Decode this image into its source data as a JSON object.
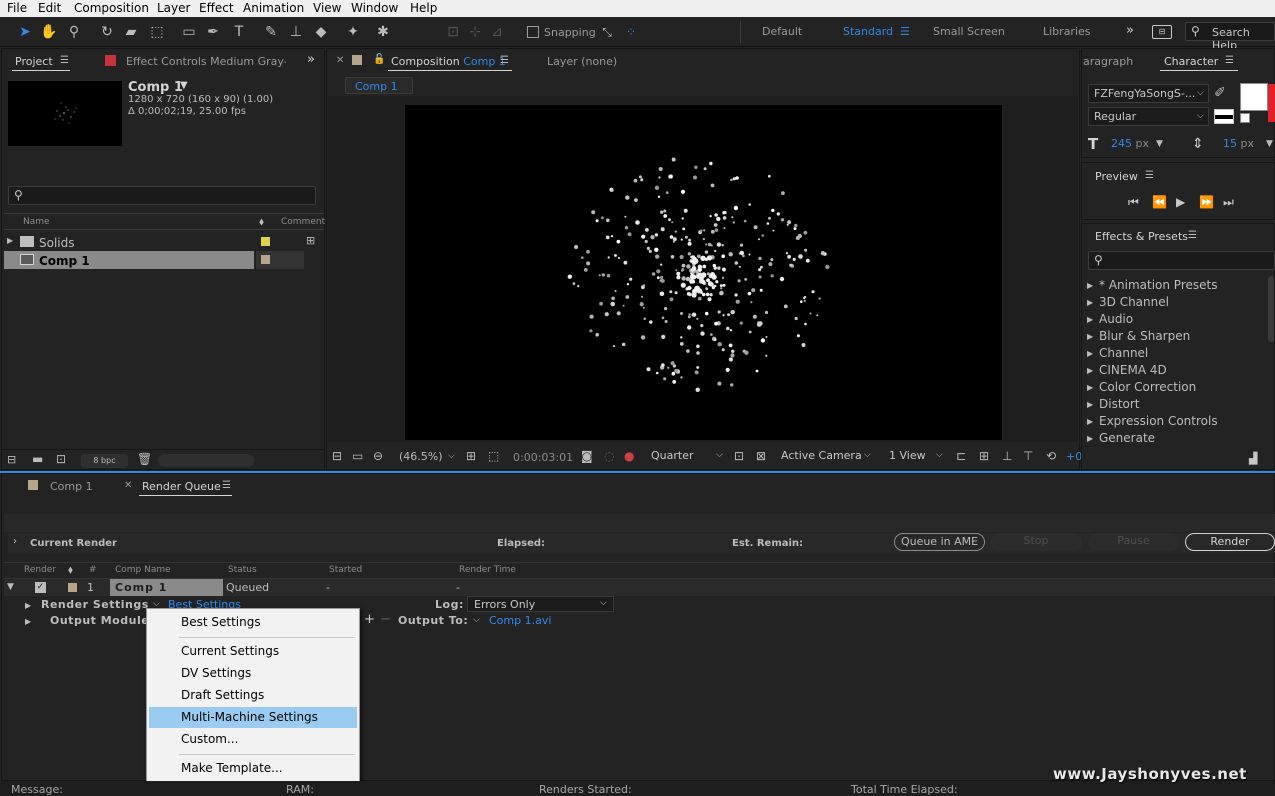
{
  "menubar": [
    "File",
    "Edit",
    "Composition",
    "Layer",
    "Effect",
    "Animation",
    "View",
    "Window",
    "Help"
  ],
  "toolbar": {
    "snapping": "Snapping",
    "workspaces": [
      "Default",
      "Standard",
      "Small Screen",
      "Libraries"
    ],
    "active_workspace": "Standard",
    "search_help": "Search Help"
  },
  "project": {
    "tab_project": "Project",
    "tab_effect_controls": "Effect Controls Medium Gray-Re",
    "comp_name": "Comp 1",
    "comp_dims": "1280 x 720  (160 x 90) (1.00)",
    "comp_duration": "Δ 0;00;02;19, 25.00 fps",
    "col_name": "Name",
    "col_comment": "Comment",
    "items": [
      {
        "name": "Solids",
        "type": "folder",
        "label_color": "#e0d24a"
      },
      {
        "name": "Comp 1",
        "type": "comp",
        "label_color": "#b7a58a"
      }
    ],
    "bpc": "8 bpc"
  },
  "composition": {
    "tab_label": "Composition",
    "tab_comp": "Comp 1",
    "tab_layer": "Layer (none)",
    "breadcrumb": "Comp 1",
    "zoom": "(46.5%)",
    "timecode": "0:00:03:01",
    "resolution": "Quarter",
    "camera": "Active Camera",
    "views": "1 View",
    "extra": "+0"
  },
  "character": {
    "tab_paragraph": "aragraph",
    "tab_character": "Character",
    "font": "FZFengYaSongS-...",
    "style": "Regular",
    "size": "245",
    "size_unit": "px",
    "leading": "15",
    "leading_unit": "px"
  },
  "preview": {
    "title": "Preview"
  },
  "effects": {
    "title": "Effects & Presets",
    "items": [
      "* Animation Presets",
      "3D Channel",
      "Audio",
      "Blur & Sharpen",
      "Channel",
      "CINEMA 4D",
      "Color Correction",
      "Distort",
      "Expression Controls",
      "Generate"
    ]
  },
  "render_queue": {
    "tab_comp": "Comp 1",
    "tab_queue": "Render Queue",
    "current_render": "Current Render",
    "elapsed": "Elapsed:",
    "est_remain": "Est. Remain:",
    "btn_queue_ame": "Queue in AME",
    "btn_stop": "Stop",
    "btn_pause": "Pause",
    "btn_render": "Render",
    "columns": [
      "Render",
      "#",
      "Comp Name",
      "Status",
      "Started",
      "Render Time"
    ],
    "item": {
      "index": "1",
      "comp_name": "Comp 1",
      "status": "Queued",
      "started": "-",
      "render_time": "-"
    },
    "render_settings_label": "Render Settings",
    "render_settings_value": "Best Settings",
    "log_label": "Log:",
    "log_value": "Errors Only",
    "output_module_label": "Output Module",
    "output_to_label": "Output To:",
    "output_to_value": "Comp 1.avi"
  },
  "popup_menu": {
    "items": [
      "Best Settings",
      "Current Settings",
      "DV Settings",
      "Draft Settings",
      "Multi-Machine Settings",
      "Custom...",
      "Make Template..."
    ],
    "selected": "Multi-Machine Settings"
  },
  "statusbar": {
    "message": "Message:",
    "ram": "RAM:",
    "renders_started": "Renders Started:",
    "total_time": "Total Time Elapsed:"
  },
  "watermark": "www.Jayshonyves.net"
}
